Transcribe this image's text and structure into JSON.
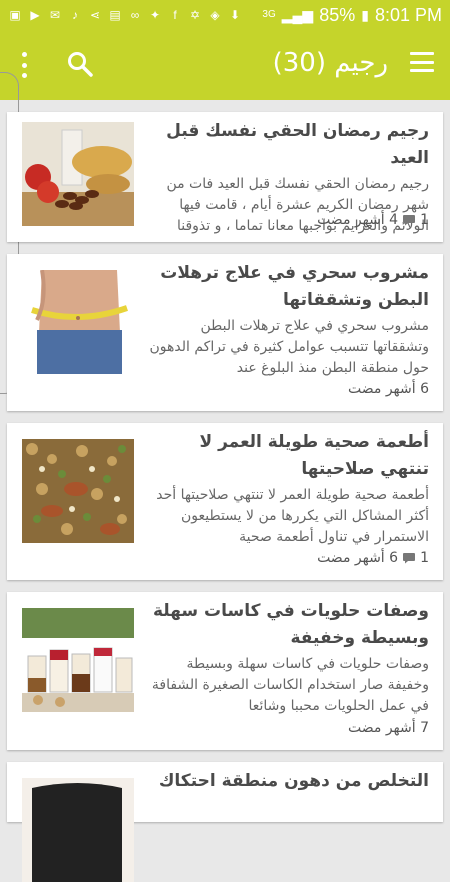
{
  "status": {
    "network": "3G",
    "battery": "85%",
    "time": "8:01 PM"
  },
  "appbar": {
    "title": "رجيم (30)"
  },
  "articles": [
    {
      "title": "رجيم رمضان الحقي نفسك قبل العيد",
      "excerpt": "رجيم رمضان الحقي نفسك قبل العيد فات من شهر رمضان الكريم عشرة أيام ، قامت فيها الولائم والعزايم بواجبها معانا تماما ، و تذوقنا",
      "comments": "1",
      "age": "4 أشهر مضت"
    },
    {
      "title": "مشروب سحري في علاج ترهلات البطن وتشققاتها",
      "excerpt": "مشروب سحري في علاج ترهلات البطن وتشققاتها تتسبب عوامل كثيرة في تراكم الدهون حول منطقة البطن منذ البلوغ عند",
      "comments": "",
      "age": "6 أشهر مضت"
    },
    {
      "title": "أطعمة صحية طويلة العمر لا تنتهي صلاحيتها",
      "excerpt": "أطعمة صحية طويلة العمر لا تنتهي صلاحيتها أحد أكثر المشاكل التي يكررها من لا يستطيعون الاستمرار في تناول أطعمة صحية",
      "comments": "1",
      "age": "6 أشهر مضت"
    },
    {
      "title": "وصفات حلويات في كاسات سهلة وبسيطة وخفيفة",
      "excerpt": "وصفات حلويات في كاسات سهلة وبسيطة وخفيفة صار استخدام الكاسات الصغيرة الشفافة في عمل الحلويات محببا وشائعا",
      "comments": "",
      "age": "7 أشهر مضت"
    },
    {
      "title": "التخلص من دهون منطقة احتكاك",
      "excerpt": "",
      "comments": "",
      "age": ""
    }
  ],
  "icons": {
    "menu": "hamburger-icon",
    "search": "search-icon",
    "overflow": "more-vertical-icon",
    "comment": "comment-bubble-icon"
  },
  "colors": {
    "accent": "#c5d42b",
    "background": "#e8e8e8"
  }
}
